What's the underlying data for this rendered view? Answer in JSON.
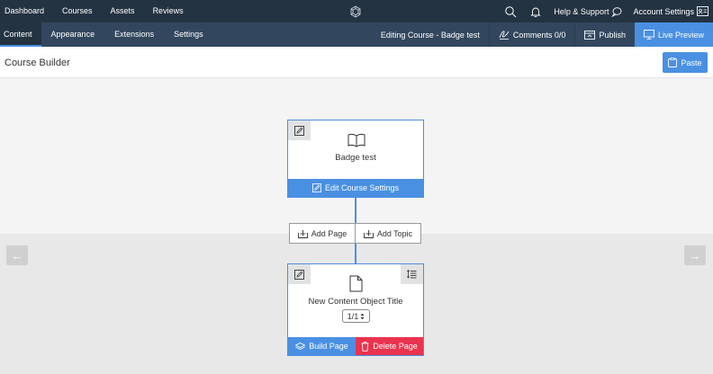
{
  "topnav": {
    "items": [
      "Dashboard",
      "Courses",
      "Assets",
      "Reviews"
    ],
    "help_label": "Help & Support",
    "account_label": "Account Settings"
  },
  "subnav": {
    "tabs": [
      "Content",
      "Appearance",
      "Extensions",
      "Settings"
    ],
    "active_tab": "Content",
    "editing_label": "Editing Course - Badge test",
    "comments_label": "Comments 0/0",
    "publish_label": "Publish",
    "live_preview_label": "Live Preview"
  },
  "titlebar": {
    "title": "Course Builder",
    "paste_label": "Paste"
  },
  "course_card": {
    "name": "Badge test",
    "edit_settings_label": "Edit Course Settings"
  },
  "add_buttons": {
    "add_page_label": "Add Page",
    "add_topic_label": "Add Topic"
  },
  "page_card": {
    "name": "New Content Object Title",
    "pager_value": "1/1",
    "build_label": "Build Page",
    "delete_label": "Delete Page"
  },
  "arrows": {
    "left": "←",
    "right": "→"
  },
  "colors": {
    "topbar": "#243342",
    "subbar": "#32475e",
    "accent": "#4a90e2",
    "danger": "#e9334f"
  }
}
